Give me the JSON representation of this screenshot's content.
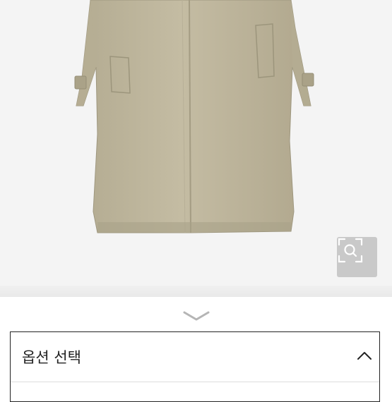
{
  "product": {
    "image_description_icon": "trench-coat-image",
    "coat_color": "#bfb69c",
    "zoom_icon": "magnifier-expand-icon"
  },
  "divider": {
    "chevron_icon": "chevron-down-icon"
  },
  "option_select": {
    "label": "옵션 선택",
    "state_icon": "chevron-up-icon"
  },
  "colors": {
    "background": "#f4f4f4",
    "border": "#222222",
    "zoom_bg": "#c9c9c9"
  }
}
